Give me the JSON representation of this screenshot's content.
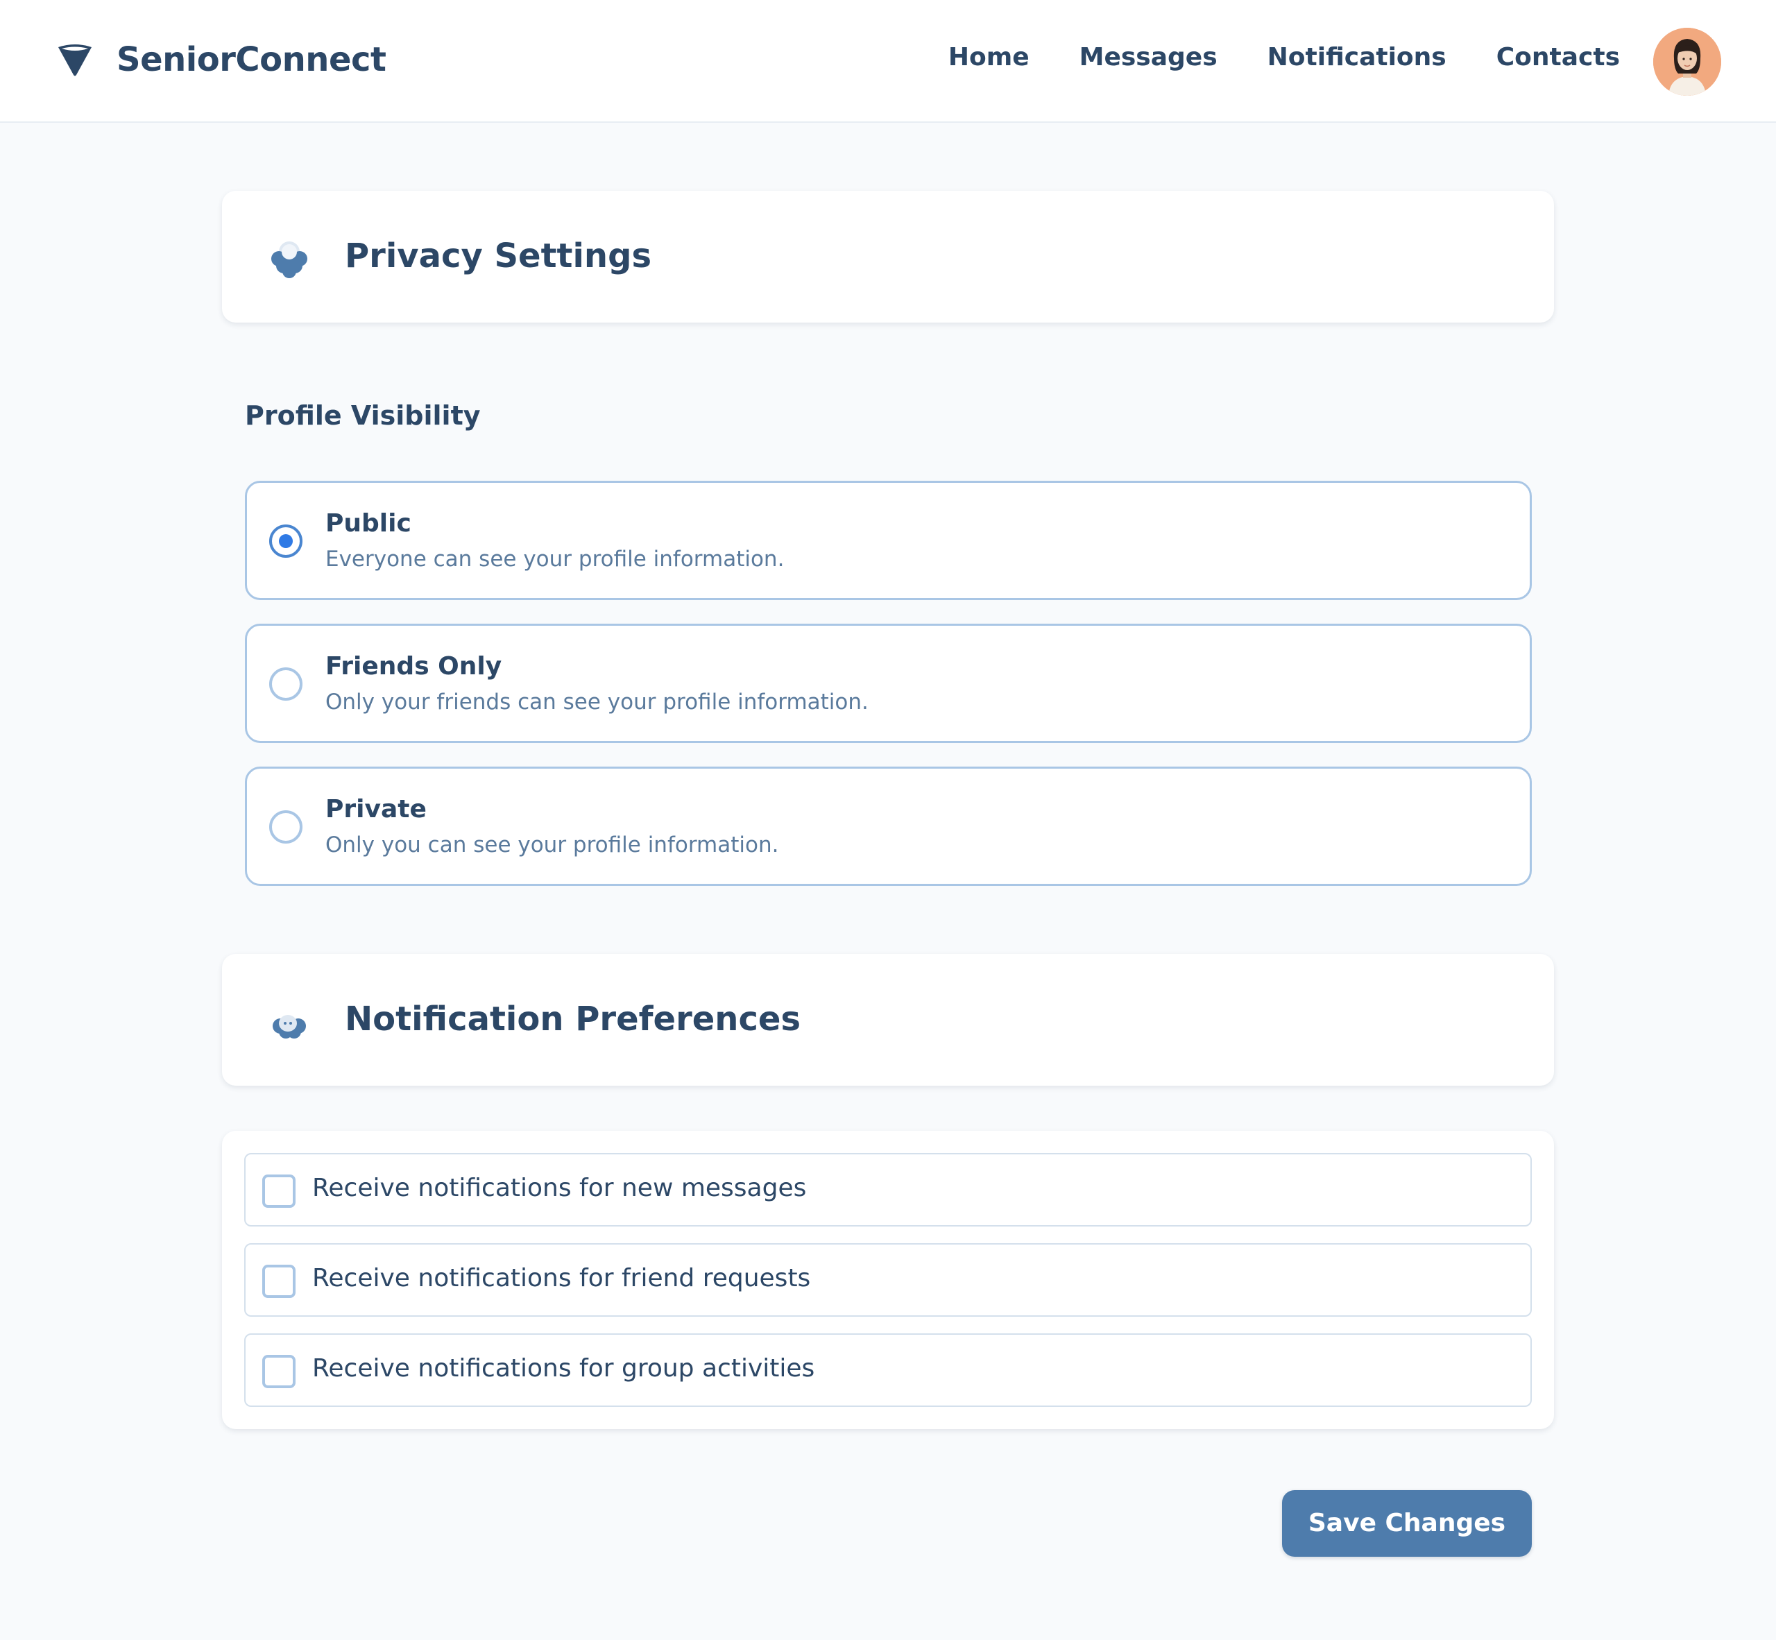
{
  "app": {
    "name": "SeniorConnect",
    "logo_icon": "funnel-logo-icon"
  },
  "nav": {
    "items": [
      {
        "label": "Home"
      },
      {
        "label": "Messages"
      },
      {
        "label": "Notifications"
      },
      {
        "label": "Contacts"
      }
    ],
    "avatar_icon": "user-avatar"
  },
  "privacy": {
    "title": "Privacy Settings",
    "icon": "privacy-cloud-icon",
    "group_label": "Profile Visibility",
    "options": [
      {
        "title": "Public",
        "description": "Everyone can see your profile information.",
        "selected": true
      },
      {
        "title": "Friends Only",
        "description": "Only your friends can see your profile information.",
        "selected": false
      },
      {
        "title": "Private",
        "description": "Only you can see your profile information.",
        "selected": false
      }
    ]
  },
  "notifications": {
    "title": "Notification Preferences",
    "icon": "notification-cloud-icon",
    "items": [
      {
        "label": "Receive notifications for new messages",
        "checked": false
      },
      {
        "label": "Receive notifications for friend requests",
        "checked": false
      },
      {
        "label": "Receive notifications for group activities",
        "checked": false
      }
    ]
  },
  "actions": {
    "save_label": "Save Changes"
  },
  "colors": {
    "primary_text": "#2c4766",
    "accent": "#4e7cac",
    "radio_border": "#a9c6e5",
    "radio_checked": "#2f7ae5",
    "page_bg": "#f8fafc"
  }
}
